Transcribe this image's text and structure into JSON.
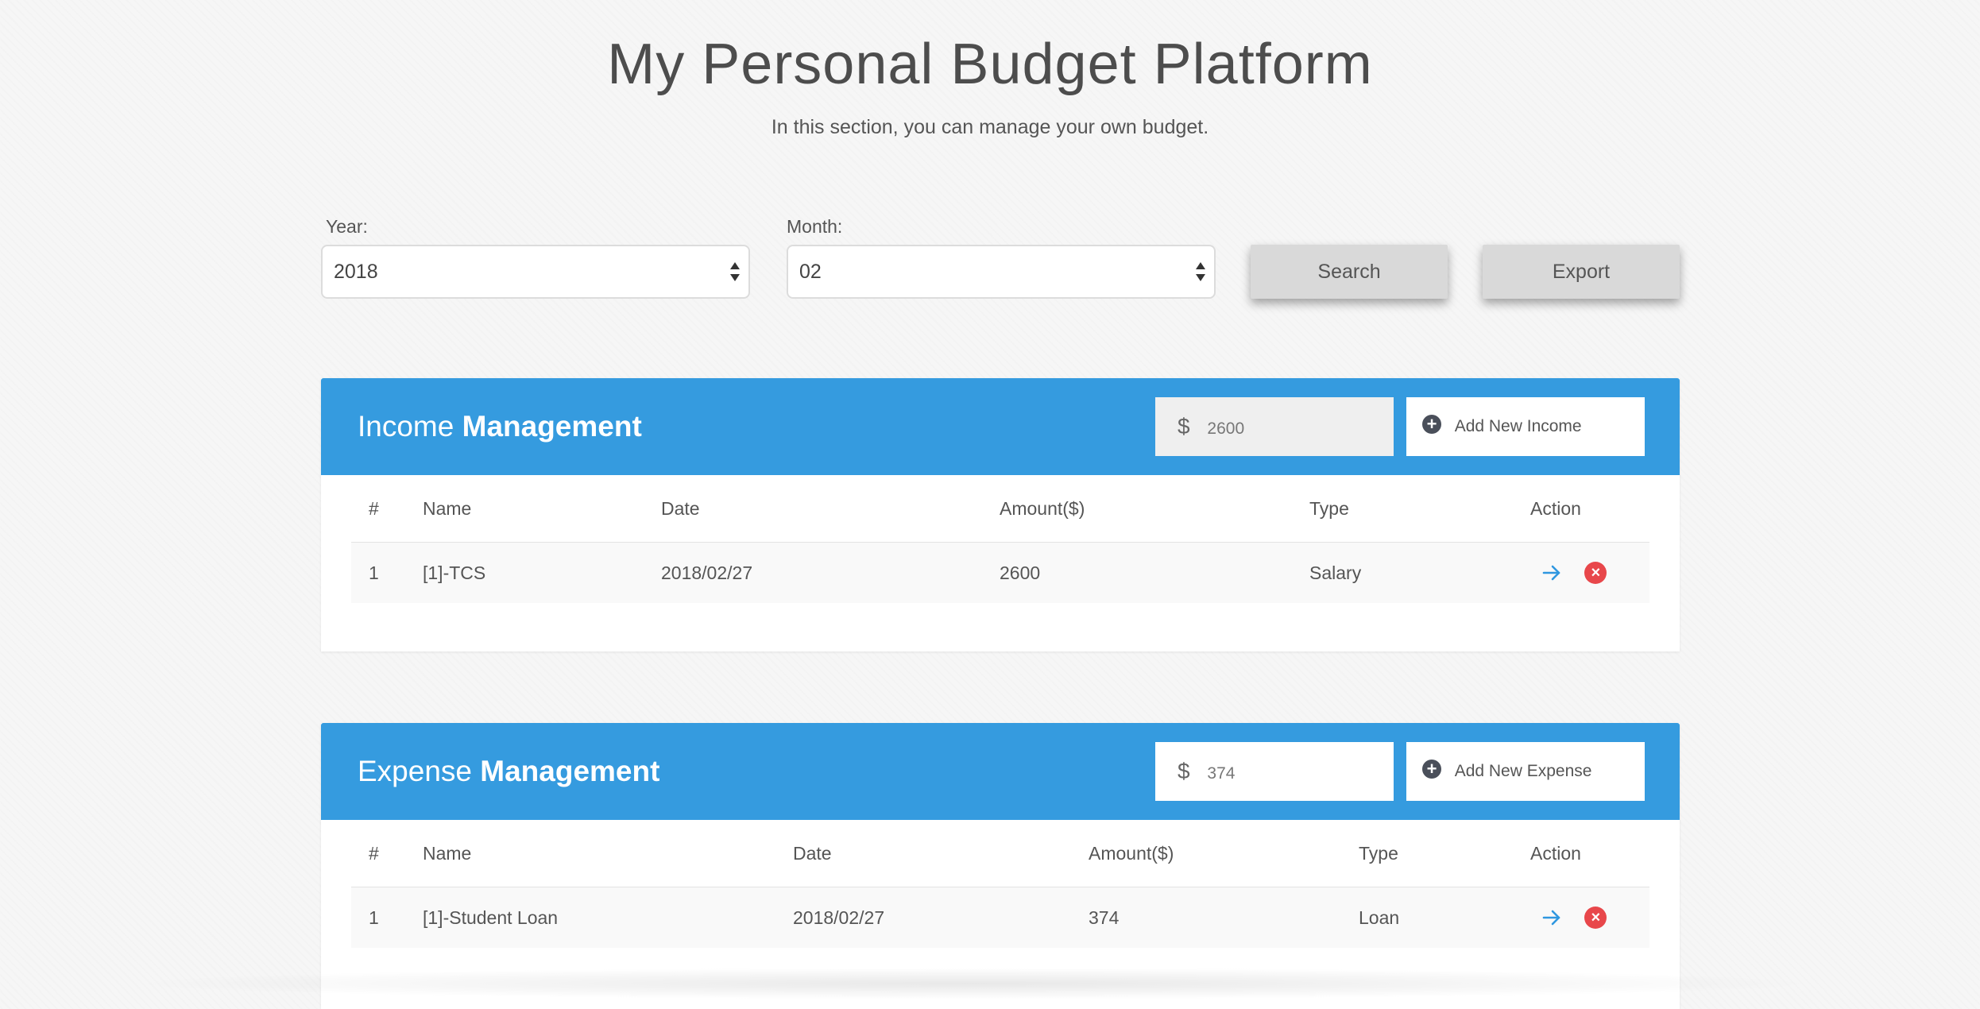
{
  "header": {
    "title": "My Personal Budget Platform",
    "subtitle": "In this section, you can manage your own budget."
  },
  "filters": {
    "year_label": "Year:",
    "year_value": "2018",
    "month_label": "Month:",
    "month_value": "02",
    "search_label": "Search",
    "export_label": "Export"
  },
  "income": {
    "title_light": "Income",
    "title_bold": "Management",
    "total": "2600",
    "add_label": "Add New Income",
    "columns": [
      "#",
      "Name",
      "Date",
      "Amount($)",
      "Type",
      "Action"
    ],
    "rows": [
      {
        "num": "1",
        "name": "[1]-TCS",
        "date": "2018/02/27",
        "amount": "2600",
        "type": "Salary"
      }
    ]
  },
  "expense": {
    "title_light": "Expense",
    "title_bold": "Management",
    "total": "374",
    "add_label": "Add New Expense",
    "columns": [
      "#",
      "Name",
      "Date",
      "Amount($)",
      "Type",
      "Action"
    ],
    "rows": [
      {
        "num": "1",
        "name": "[1]-Student Loan",
        "date": "2018/02/27",
        "amount": "374",
        "type": "Loan"
      }
    ]
  },
  "icons": {
    "dollar": "dollar-icon",
    "plus": "plus-circle-icon",
    "view": "arrow-right-icon",
    "delete": "close-circle-icon"
  },
  "colors": {
    "panel_header": "#359bdf",
    "delete_icon": "#e8474b",
    "view_icon": "#2f97e0"
  }
}
